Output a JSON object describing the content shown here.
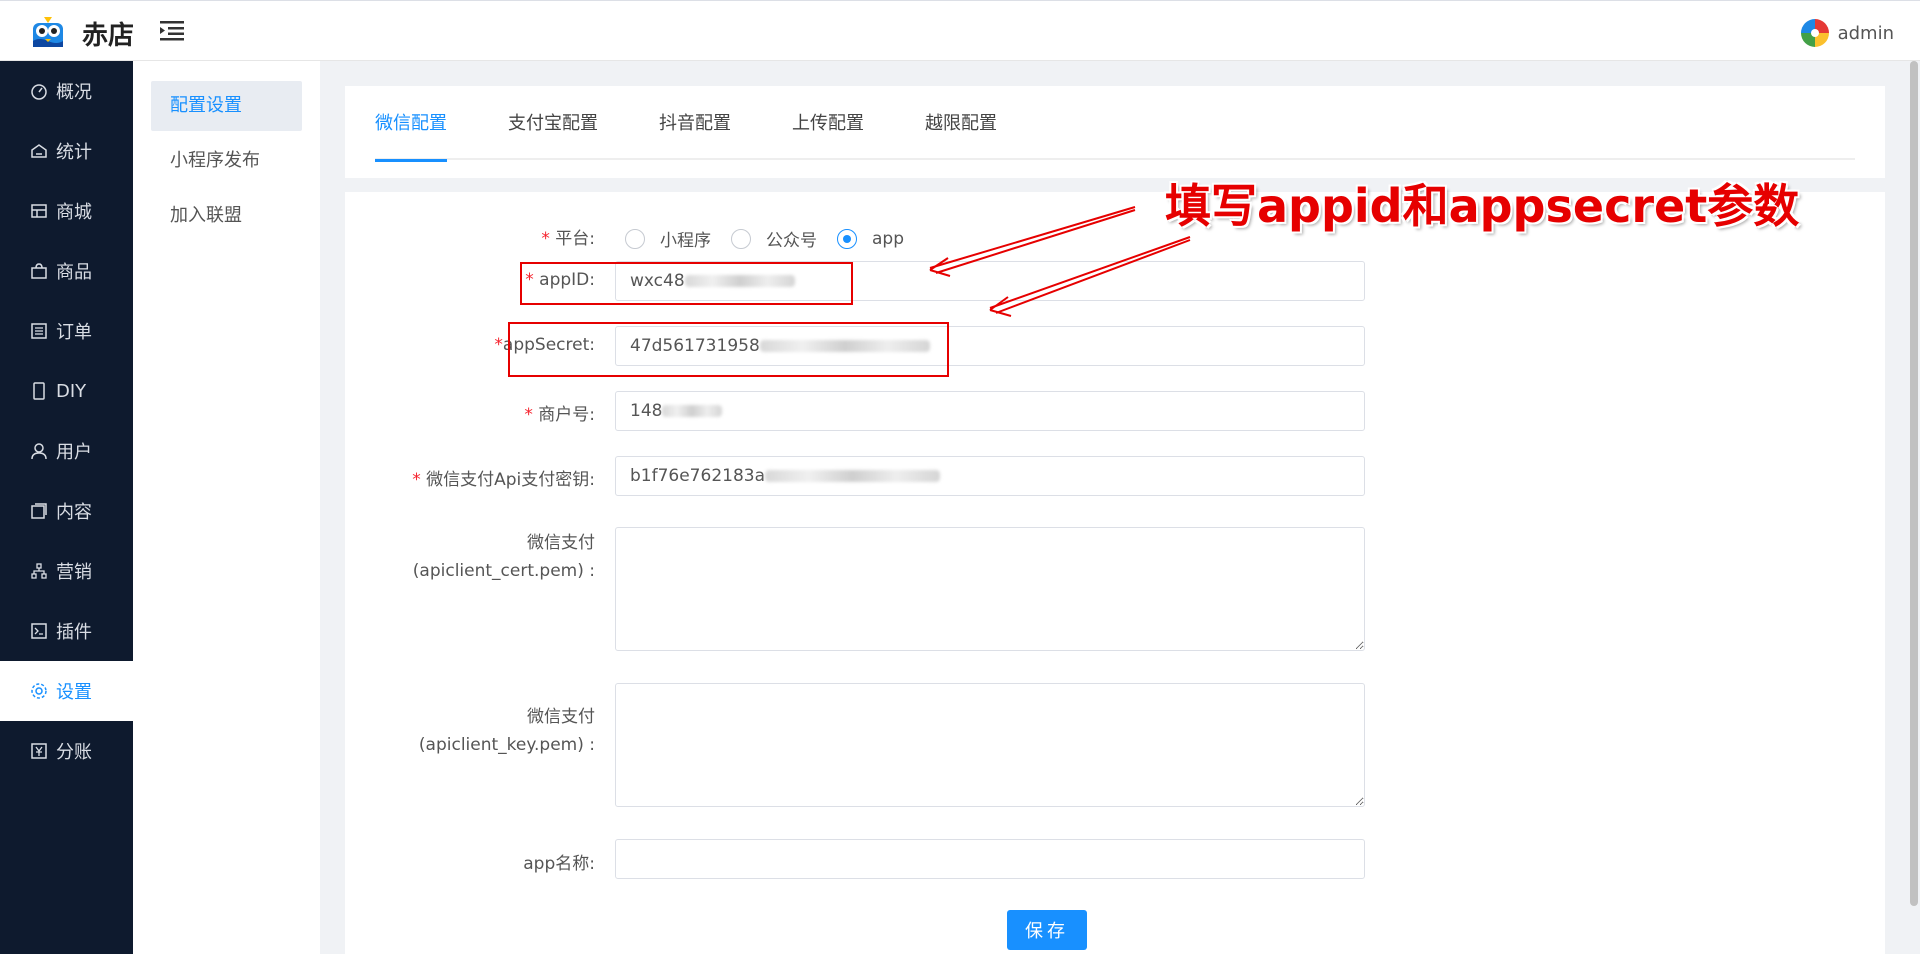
{
  "header": {
    "app_name": "赤店",
    "user_name": "admin"
  },
  "sidebar": {
    "items": [
      {
        "label": "概况",
        "icon": "dashboard-icon"
      },
      {
        "label": "统计",
        "icon": "stats-icon"
      },
      {
        "label": "商城",
        "icon": "mall-icon"
      },
      {
        "label": "商品",
        "icon": "bag-icon"
      },
      {
        "label": "订单",
        "icon": "order-icon"
      },
      {
        "label": "DIY",
        "icon": "mobile-icon"
      },
      {
        "label": "用户",
        "icon": "user-icon"
      },
      {
        "label": "内容",
        "icon": "content-icon"
      },
      {
        "label": "营销",
        "icon": "marketing-icon"
      },
      {
        "label": "插件",
        "icon": "plugin-icon"
      },
      {
        "label": "设置",
        "icon": "gear-icon"
      },
      {
        "label": "分账",
        "icon": "yen-icon"
      }
    ],
    "active_index": 10
  },
  "submenu": {
    "items": [
      "配置设置",
      "小程序发布",
      "加入联盟"
    ],
    "active_index": 0
  },
  "tabs": {
    "items": [
      "微信配置",
      "支付宝配置",
      "抖音配置",
      "上传配置",
      "越限配置"
    ],
    "active_index": 0
  },
  "form": {
    "platform": {
      "label": "平台:",
      "options": [
        "小程序",
        "公众号",
        "app"
      ],
      "selected": "app"
    },
    "appid": {
      "label": "appID:",
      "value": "wxc48"
    },
    "appsecret": {
      "label": "appSecret:",
      "value": "47d561731958"
    },
    "merchant_no": {
      "label": "商户号:",
      "value": "148"
    },
    "api_key": {
      "label": "微信支付Api支付密钥:",
      "value": "b1f76e762183a"
    },
    "cert": {
      "label_line1": "微信支付",
      "label_line2": "(apiclient_cert.pem) :"
    },
    "key": {
      "label_line1": "微信支付",
      "label_line2": "(apiclient_key.pem) :"
    },
    "app_name": {
      "label": "app名称:",
      "value": ""
    },
    "save_label": "保存"
  },
  "annotation": {
    "text": "填写appid和appsecret参数",
    "color": "#e60000"
  },
  "colors": {
    "accent": "#1890ff",
    "sidebar_bg": "#0e1a2e",
    "required": "#f5222d"
  }
}
